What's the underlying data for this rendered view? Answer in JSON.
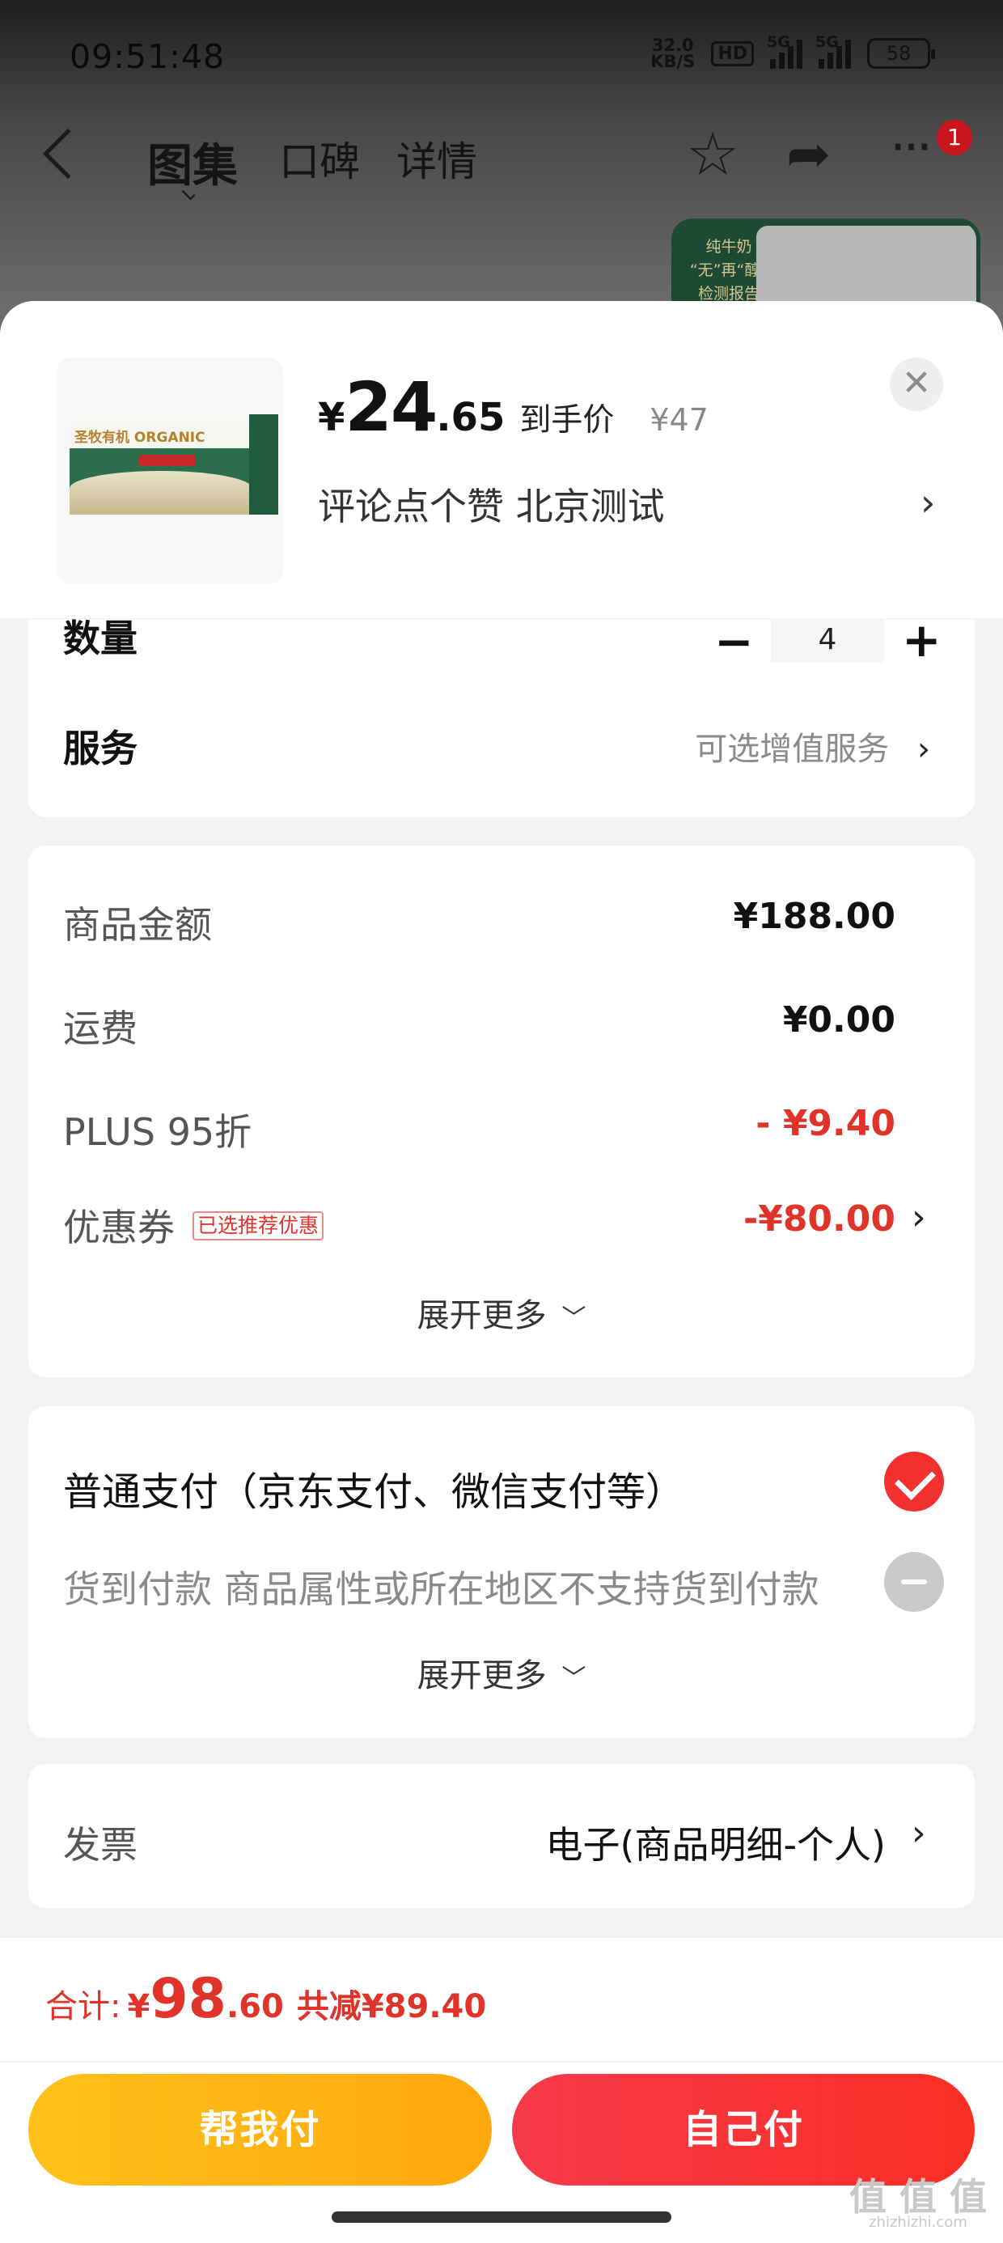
{
  "status_bar": {
    "time": "09:51:48",
    "net_speed_value": "32.0",
    "net_speed_unit": "KB/S",
    "hd_badge": "HD",
    "signal1_label": "5G",
    "signal2_label": "5G",
    "battery": "58"
  },
  "nav": {
    "tabs": [
      {
        "label": "图集"
      },
      {
        "label": "口碑"
      },
      {
        "label": "详情"
      }
    ],
    "notification_count": "1",
    "thumb_report_text": "纯牛奶 “无”再“醇” 检测报告"
  },
  "product": {
    "price_symbol": "¥",
    "price_integer": "24",
    "price_decimal": ".65",
    "price_tag": "到手价",
    "original_price": "¥47",
    "promo_text": "评论点个赞  北京测试",
    "box_brand": "圣牧有机 ORGANIC"
  },
  "quantity": {
    "label": "数量",
    "value": "4"
  },
  "service": {
    "label": "服务",
    "value": "可选增值服务"
  },
  "amounts": {
    "rows": [
      {
        "label": "商品金额",
        "value": "¥188.00"
      },
      {
        "label": "运费",
        "value": "¥0.00"
      },
      {
        "label": "PLUS 95折",
        "value": "- ¥9.40"
      },
      {
        "label": "优惠券",
        "value": "-¥80.00",
        "badge": "已选推荐优惠"
      }
    ],
    "expand_label": "展开更多"
  },
  "payment": {
    "normal_label": "普通支付（京东支付、微信支付等）",
    "cod_label": "货到付款 商品属性或所在地区不支持货到付款",
    "expand_label": "展开更多"
  },
  "invoice": {
    "label": "发票",
    "value": "电子(商品明细-个人)"
  },
  "footer": {
    "total_label": "合计:",
    "total_symbol": "¥",
    "total_integer": "98",
    "total_decimal": ".60",
    "discount_text": "共减¥89.40",
    "help_pay_label": "帮我付",
    "self_pay_label": "自己付",
    "watermark": "值 值 值",
    "watermark_sub": "zhizhizhi.com"
  },
  "colors": {
    "accent_red": "#e0332a",
    "help_pay_yellow": "#ffb716",
    "self_pay_red": "#f6394a"
  }
}
